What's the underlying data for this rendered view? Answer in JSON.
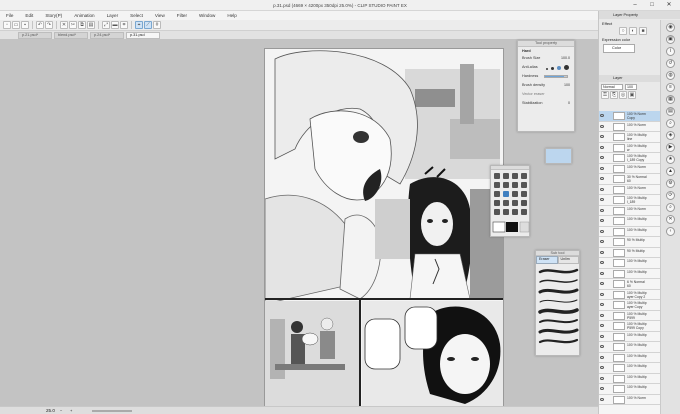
{
  "window": {
    "title": "p.31.psd (4669 × 4200px 350dpi 25.0%) - CLIP STUDIO PAINT EX",
    "minimize": "–",
    "maximize": "□",
    "close": "✕"
  },
  "menu": [
    "File",
    "Edit",
    "Story(P)",
    "Animation",
    "Layer",
    "Select",
    "View",
    "Filter",
    "Window",
    "Help"
  ],
  "toolbar_icons": [
    "new-icon",
    "open-icon",
    "save-icon",
    "undo-icon",
    "redo-icon",
    "clear-icon",
    "cut-icon",
    "copy-icon",
    "paste-icon",
    "transform-icon",
    "ruler-icon",
    "snap-icon",
    "grid-icon"
  ],
  "tabs": [
    {
      "label": "p.21.psd*",
      "active": false
    },
    {
      "label": "blend.psd*",
      "active": false
    },
    {
      "label": "p.24.psd*",
      "active": false
    },
    {
      "label": "p.31.psd",
      "active": true
    }
  ],
  "status": {
    "zoom": "25.0"
  },
  "tool_property": {
    "title": "Tool property",
    "tool_name": "Hard",
    "brush_size_label": "Brush Size",
    "brush_size_value": "100.0",
    "anti_alias_label": "Anti-alias",
    "hardness_label": "Hardness",
    "hardness_fraction": 0.85,
    "brush_density_label": "Brush density",
    "brush_density_value": "100",
    "brush_density_fraction": 1.0,
    "stroke_label": "Stabilization",
    "stroke_value": "0",
    "extra_label": "Vector eraser"
  },
  "sub_tool": {
    "title": "Sub tool",
    "tab_eraser": "Eraser",
    "tab_other": "Unlim"
  },
  "right_panel": {
    "layer_property_title": "Layer Property",
    "effect_label": "Effect",
    "expression_color_label": "Expression color",
    "expression_color_value": "Color",
    "layer_title": "Layer",
    "blend_value": "Normal",
    "opacity_value": "100"
  },
  "layers": [
    {
      "name": "100 % Norm",
      "sub": "Copy",
      "selected": true
    },
    {
      "name": "100 % Norm",
      "sub": "",
      "selected": false
    },
    {
      "name": "100 % Multip",
      "sub": "line",
      "selected": false
    },
    {
      "name": "100 % Multip",
      "sub": "w",
      "selected": false
    },
    {
      "name": "100 % Multip",
      "sub": "l_189 Copy",
      "selected": false
    },
    {
      "name": "100 % Norm",
      "sub": "",
      "selected": false
    },
    {
      "name": "30 % Normal",
      "sub": "60",
      "selected": false
    },
    {
      "name": "100 % Norm",
      "sub": "",
      "selected": false
    },
    {
      "name": "100 % Multip",
      "sub": "l_189",
      "selected": false
    },
    {
      "name": "100 % Norm",
      "sub": "",
      "selected": false
    },
    {
      "name": "100 % Multip",
      "sub": "",
      "selected": false
    },
    {
      "name": "100 % Multip",
      "sub": "",
      "selected": false
    },
    {
      "name": "90 % Multip",
      "sub": "",
      "selected": false
    },
    {
      "name": "90 % Multip",
      "sub": "",
      "selected": false
    },
    {
      "name": "100 % Multip",
      "sub": "",
      "selected": false
    },
    {
      "name": "100 % Multip",
      "sub": "",
      "selected": false
    },
    {
      "name": "6 % Normal",
      "sub": "60",
      "selected": false
    },
    {
      "name": "100 % Multip",
      "sub": "ayer Copy 2",
      "selected": false
    },
    {
      "name": "100 % Multip",
      "sub": "ayer Copy",
      "selected": false
    },
    {
      "name": "100 % Multip",
      "sub": "P599",
      "selected": false
    },
    {
      "name": "100 % Multip",
      "sub": "P599 Copy",
      "selected": false
    },
    {
      "name": "100 % Multip",
      "sub": "",
      "selected": false
    },
    {
      "name": "100 % Multip",
      "sub": "",
      "selected": false
    },
    {
      "name": "100 % Multip",
      "sub": "",
      "selected": false
    },
    {
      "name": "100 % Multip",
      "sub": "",
      "selected": false
    },
    {
      "name": "100 % Multip",
      "sub": "",
      "selected": false
    },
    {
      "name": "100 % Multip",
      "sub": "",
      "selected": false
    },
    {
      "name": "100 % Norm",
      "sub": "",
      "selected": false
    }
  ],
  "colors": {
    "selection_blue": "#bcd6ee",
    "accent": "#6da4d8",
    "workspace": "#c3c3c3",
    "canvas_paper": "#f7f7f7"
  }
}
